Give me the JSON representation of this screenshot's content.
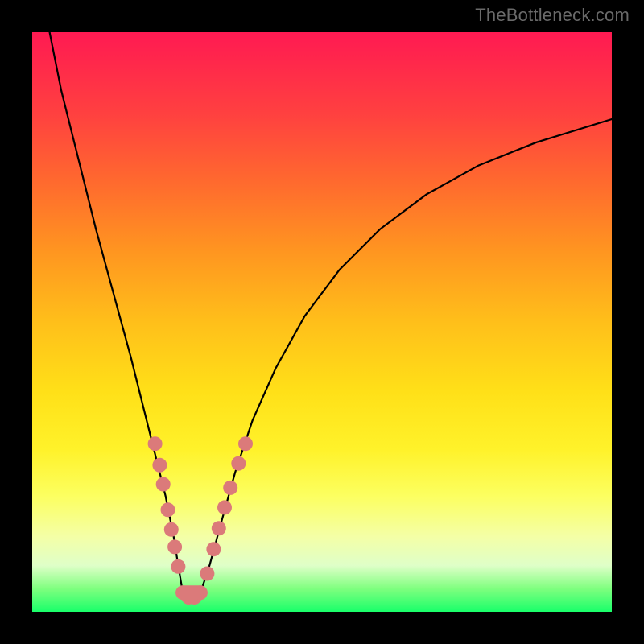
{
  "watermark": "TheBottleneck.com",
  "colors": {
    "frame_bg": "#000000",
    "gradient_top": "#ff1a52",
    "gradient_bottom": "#19ff6a",
    "curve": "#000000",
    "marker": "#db7a7a"
  },
  "chart_data": {
    "type": "line",
    "title": "",
    "xlabel": "",
    "ylabel": "",
    "xlim": [
      0,
      100
    ],
    "ylim": [
      0,
      100
    ],
    "series": [
      {
        "name": "bottleneck-curve",
        "x": [
          3,
          5,
          8,
          11,
          14,
          17,
          19,
          21,
          23,
          24.4,
          25.2,
          26,
          27,
          28,
          29,
          30.6,
          32.5,
          35,
          38,
          42,
          47,
          53,
          60,
          68,
          77,
          87,
          100
        ],
        "y": [
          100,
          90,
          78,
          66,
          55,
          44,
          36,
          28,
          20,
          13,
          8,
          3.2,
          2.4,
          2.4,
          3.2,
          8,
          15,
          24,
          33,
          42,
          51,
          59,
          66,
          72,
          77,
          81,
          85
        ]
      }
    ],
    "markers": {
      "name": "highlighted-points",
      "points": [
        {
          "x": 21.2,
          "y": 29.0
        },
        {
          "x": 22.0,
          "y": 25.3
        },
        {
          "x": 22.6,
          "y": 22.0
        },
        {
          "x": 23.4,
          "y": 17.6
        },
        {
          "x": 24.0,
          "y": 14.2
        },
        {
          "x": 24.6,
          "y": 11.2
        },
        {
          "x": 25.2,
          "y": 7.8
        },
        {
          "x": 26.0,
          "y": 3.3
        },
        {
          "x": 27.0,
          "y": 2.5
        },
        {
          "x": 28.0,
          "y": 2.5
        },
        {
          "x": 29.0,
          "y": 3.3
        },
        {
          "x": 30.2,
          "y": 6.6
        },
        {
          "x": 31.3,
          "y": 10.8
        },
        {
          "x": 32.2,
          "y": 14.4
        },
        {
          "x": 33.2,
          "y": 18.0
        },
        {
          "x": 34.2,
          "y": 21.4
        },
        {
          "x": 35.6,
          "y": 25.6
        },
        {
          "x": 36.8,
          "y": 29.0
        }
      ]
    }
  }
}
